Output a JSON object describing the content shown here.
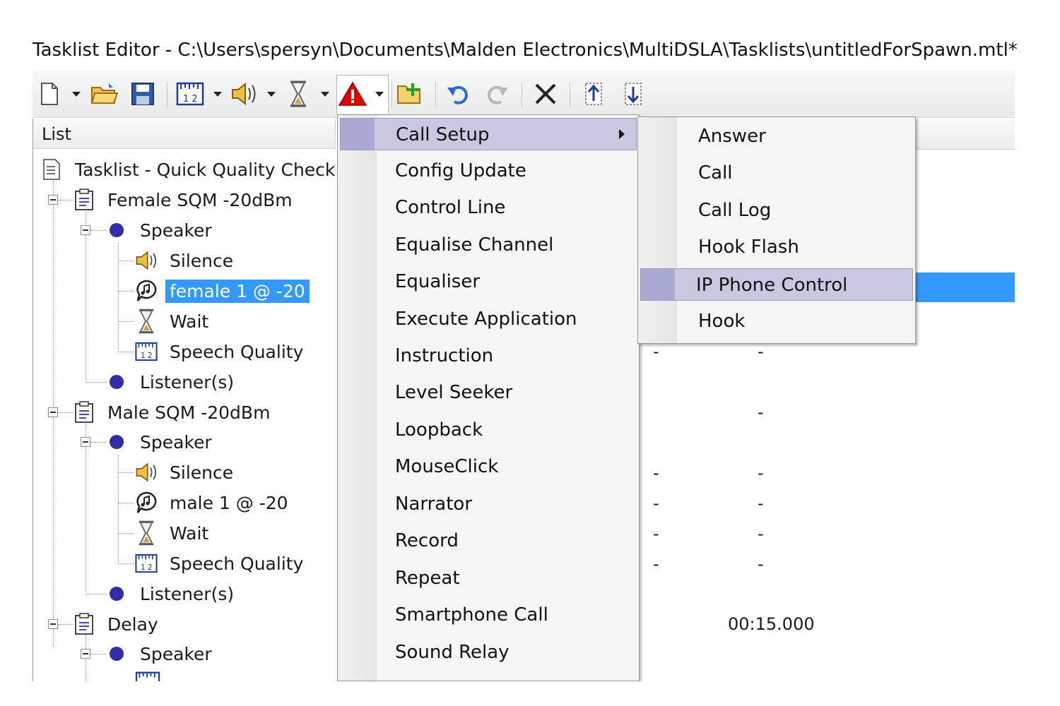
{
  "window": {
    "title": "Tasklist Editor - C:\\Users\\spersyn\\Documents\\Malden Electronics\\MultiDSLA\\Tasklists\\untitledForSpawn.mtl*"
  },
  "toolbar": {
    "buttons": [
      {
        "name": "new-icon"
      },
      {
        "name": "open-folder-icon"
      },
      {
        "name": "save-icon"
      },
      {
        "name": "speech-quality-icon"
      },
      {
        "name": "speaker-icon"
      },
      {
        "name": "hourglass-icon"
      },
      {
        "name": "warning-icon"
      },
      {
        "name": "add-task-icon"
      },
      {
        "name": "undo-icon"
      },
      {
        "name": "redo-icon"
      },
      {
        "name": "delete-icon"
      },
      {
        "name": "move-up-icon"
      },
      {
        "name": "move-down-icon"
      }
    ]
  },
  "list": {
    "header": "List",
    "nodes": [
      {
        "label": "Tasklist - Quick Quality Check",
        "icon": "tasklist-icon"
      },
      {
        "label": "Female SQM -20dBm",
        "icon": "task-icon"
      },
      {
        "label": "Speaker",
        "icon": "bullet"
      },
      {
        "label": "Silence",
        "icon": "speaker-icon"
      },
      {
        "label": "female 1 @ -20",
        "icon": "speech-icon",
        "selected": true
      },
      {
        "label": "Wait",
        "icon": "hourglass-icon"
      },
      {
        "label": "Speech Quality",
        "icon": "speech-quality-icon"
      },
      {
        "label": "Listener(s)",
        "icon": "bullet"
      },
      {
        "label": "Male SQM -20dBm",
        "icon": "task-icon"
      },
      {
        "label": "Speaker",
        "icon": "bullet"
      },
      {
        "label": "Silence",
        "icon": "speaker-icon"
      },
      {
        "label": "male 1 @ -20",
        "icon": "speech-icon"
      },
      {
        "label": "Wait",
        "icon": "hourglass-icon"
      },
      {
        "label": "Speech Quality",
        "icon": "speech-quality-icon"
      },
      {
        "label": "Listener(s)",
        "icon": "bullet"
      },
      {
        "label": "Delay",
        "icon": "task-icon"
      },
      {
        "label": "Speaker",
        "icon": "bullet"
      }
    ]
  },
  "grid": {
    "dash": "-",
    "delay_time": "00:15.000"
  },
  "menu": {
    "items": [
      {
        "label": "Call Setup",
        "hot": true,
        "submenu": true
      },
      {
        "label": "Config Update"
      },
      {
        "label": "Control Line"
      },
      {
        "label": "Equalise Channel"
      },
      {
        "label": "Equaliser"
      },
      {
        "label": "Execute Application"
      },
      {
        "label": "Instruction"
      },
      {
        "label": "Level Seeker"
      },
      {
        "label": "Loopback"
      },
      {
        "label": "MouseClick"
      },
      {
        "label": "Narrator"
      },
      {
        "label": "Record"
      },
      {
        "label": "Repeat"
      },
      {
        "label": "Smartphone Call"
      },
      {
        "label": "Sound Relay"
      }
    ]
  },
  "submenu": {
    "items": [
      {
        "label": "Answer"
      },
      {
        "label": "Call"
      },
      {
        "label": "Call Log"
      },
      {
        "label": "Hook Flash"
      },
      {
        "label": "IP Phone Control",
        "hot": true
      },
      {
        "label": "Hook"
      }
    ]
  },
  "colors": {
    "selection": "#3399ff",
    "menu_hot": "#c8c8e0",
    "bullet": "#2e2ea8",
    "warning": "#e00000"
  }
}
